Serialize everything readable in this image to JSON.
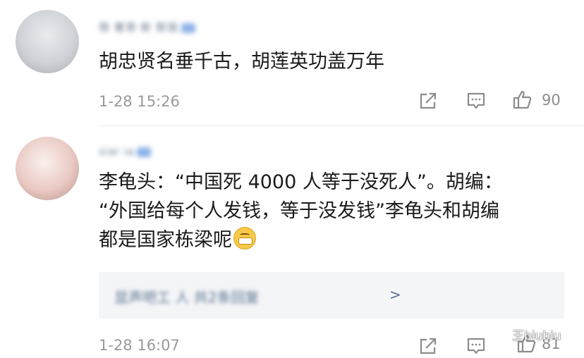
{
  "comments": [
    {
      "username": "限 著哥·新 默我",
      "content": "胡忠贤名垂千古，胡莲英功盖万年",
      "time": "1-28 15:26",
      "likes": "90"
    },
    {
      "username": "siai ia",
      "content": "李龟头：“中国死 4000 人等于没死人”。胡编：\n“外国给每个人发钱，等于没发钱”李龟头和胡编\n都是国家栋梁呢",
      "replies_blurred": "显声吧工 人 共2条回复",
      "replies_arrow": ">",
      "time": "1-28 16:07",
      "likes": "81"
    }
  ],
  "watermark": "王biubiu",
  "icons": [
    "share-icon",
    "comment-icon",
    "like-icon",
    "wechat-icon",
    "grin-emoji"
  ],
  "colors": {
    "text": "#1a1a1a",
    "meta": "#9a9a9a",
    "link": "#56708f",
    "reply_bg": "#f4f5f7"
  }
}
